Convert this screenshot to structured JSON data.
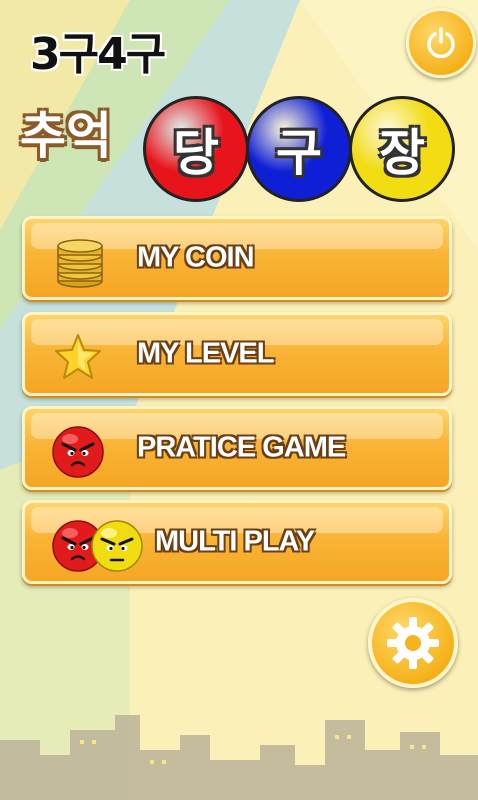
{
  "header": {
    "app_title": "3구4구",
    "logo": {
      "word": "추억",
      "balls": [
        {
          "char": "당",
          "color": "#e8141c"
        },
        {
          "char": "구",
          "color": "#0f1fd6"
        },
        {
          "char": "장",
          "color": "#f2dc12"
        }
      ]
    }
  },
  "menu": {
    "items": [
      {
        "label": "MY COIN",
        "icon": "coin-stack-icon"
      },
      {
        "label": "MY LEVEL",
        "icon": "star-icon"
      },
      {
        "label": "PRATICE GAME",
        "icon": "red-ball-icon"
      },
      {
        "label": "MULTI PLAY",
        "icon": "red-and-yellow-balls-icon"
      }
    ]
  },
  "controls": {
    "power_icon": "power-icon",
    "settings_icon": "gear-icon"
  },
  "colors": {
    "button_orange": "#f9b437",
    "background": "#fbf0b8"
  }
}
